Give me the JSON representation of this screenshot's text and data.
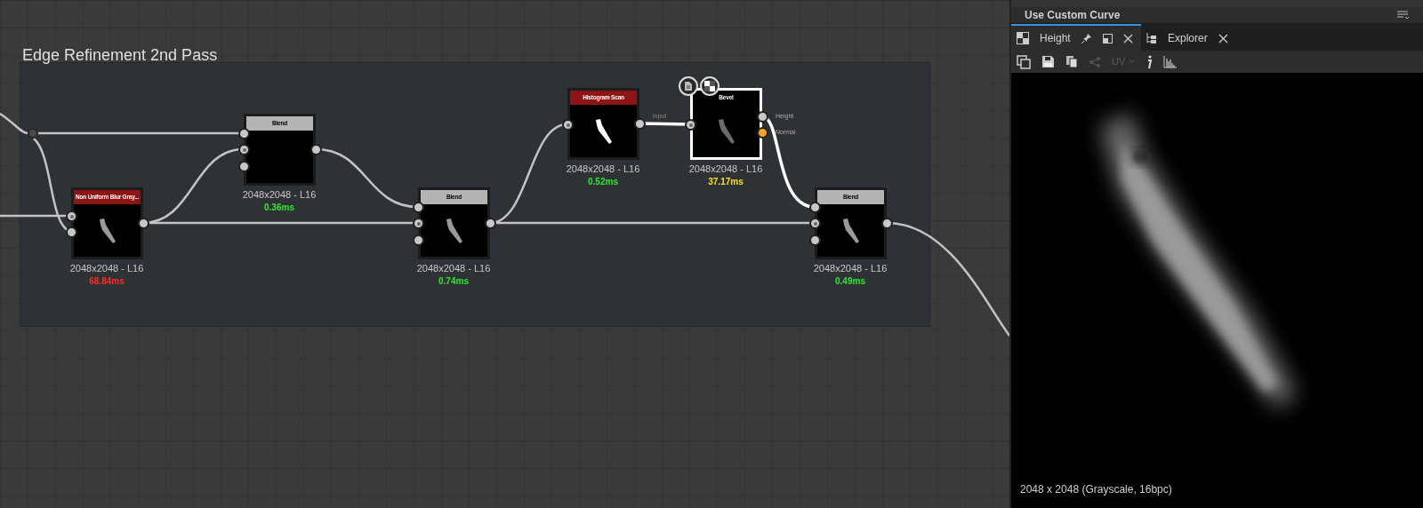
{
  "graph": {
    "frame": {
      "title": "Edge Refinement 2nd Pass"
    },
    "nodes": [
      {
        "title": "Non Uniform Blur Gray...",
        "color": "#8e1515",
        "selected": false,
        "preview": {
          "color": "#9a9a9a"
        },
        "inputs": [
          {
            "kind": "dot"
          },
          {
            "kind": "plain"
          }
        ],
        "outputs": [
          {
            "kind": "plain"
          }
        ],
        "resolution": "2048x2048 - L16",
        "timing": {
          "text": "68.84ms",
          "color": "#ff2a2a"
        }
      },
      {
        "title": "Blend",
        "color": "#b4b4b4",
        "selected": false,
        "inputs": [
          {
            "kind": "plain"
          },
          {
            "kind": "dot"
          },
          {
            "kind": "plain"
          }
        ],
        "outputs": [
          {
            "kind": "plain"
          }
        ],
        "resolution": "2048x2048 - L16",
        "timing": {
          "text": "0.36ms",
          "color": "#2ee82e"
        }
      },
      {
        "title": "Blend",
        "color": "#b4b4b4",
        "selected": false,
        "preview": {
          "color": "#9a9a9a"
        },
        "inputs": [
          {
            "kind": "plain"
          },
          {
            "kind": "dot"
          },
          {
            "kind": "plain"
          }
        ],
        "outputs": [
          {
            "kind": "plain"
          }
        ],
        "resolution": "2048x2048 - L16",
        "timing": {
          "text": "0.74ms",
          "color": "#2ee82e"
        }
      },
      {
        "title": "Histogram Scan",
        "color": "#8e1515",
        "selected": false,
        "preview": {
          "color": "#ffffff"
        },
        "inputs": [
          {
            "kind": "dot"
          }
        ],
        "outputs": [
          {
            "kind": "plain"
          }
        ],
        "resolution": "2048x2048 - L16",
        "timing": {
          "text": "0.52ms",
          "color": "#2ee82e"
        }
      },
      {
        "title": "Bevel",
        "color": "#000000",
        "selected": true,
        "preview": {
          "color": "#6a6a6a"
        },
        "inputs": [
          {
            "kind": "dot",
            "wire_label": "input"
          }
        ],
        "outputs": [
          {
            "kind": "plain",
            "label": "Height"
          },
          {
            "kind": "accent",
            "label": "Normal"
          }
        ],
        "resolution": "2048x2048 - L16",
        "timing": {
          "text": "37.17ms",
          "color": "#f2e22e"
        }
      },
      {
        "title": "Blend",
        "color": "#b4b4b4",
        "selected": false,
        "preview": {
          "color": "#9a9a9a"
        },
        "inputs": [
          {
            "kind": "plain"
          },
          {
            "kind": "dot"
          },
          {
            "kind": "plain"
          }
        ],
        "outputs": [
          {
            "kind": "plain"
          }
        ],
        "resolution": "2048x2048 - L16",
        "timing": {
          "text": "0.49ms",
          "color": "#2ee82e"
        }
      }
    ]
  },
  "panel": {
    "header": {
      "title": "Use Custom Curve"
    },
    "tabs": [
      {
        "label": "Height",
        "selected": true
      },
      {
        "label": "Explorer",
        "selected": false
      }
    ],
    "toolbar": {
      "uv": {
        "label": "UV",
        "disabled": true
      }
    },
    "status": "2048 x 2048 (Grayscale, 16bpc)"
  }
}
